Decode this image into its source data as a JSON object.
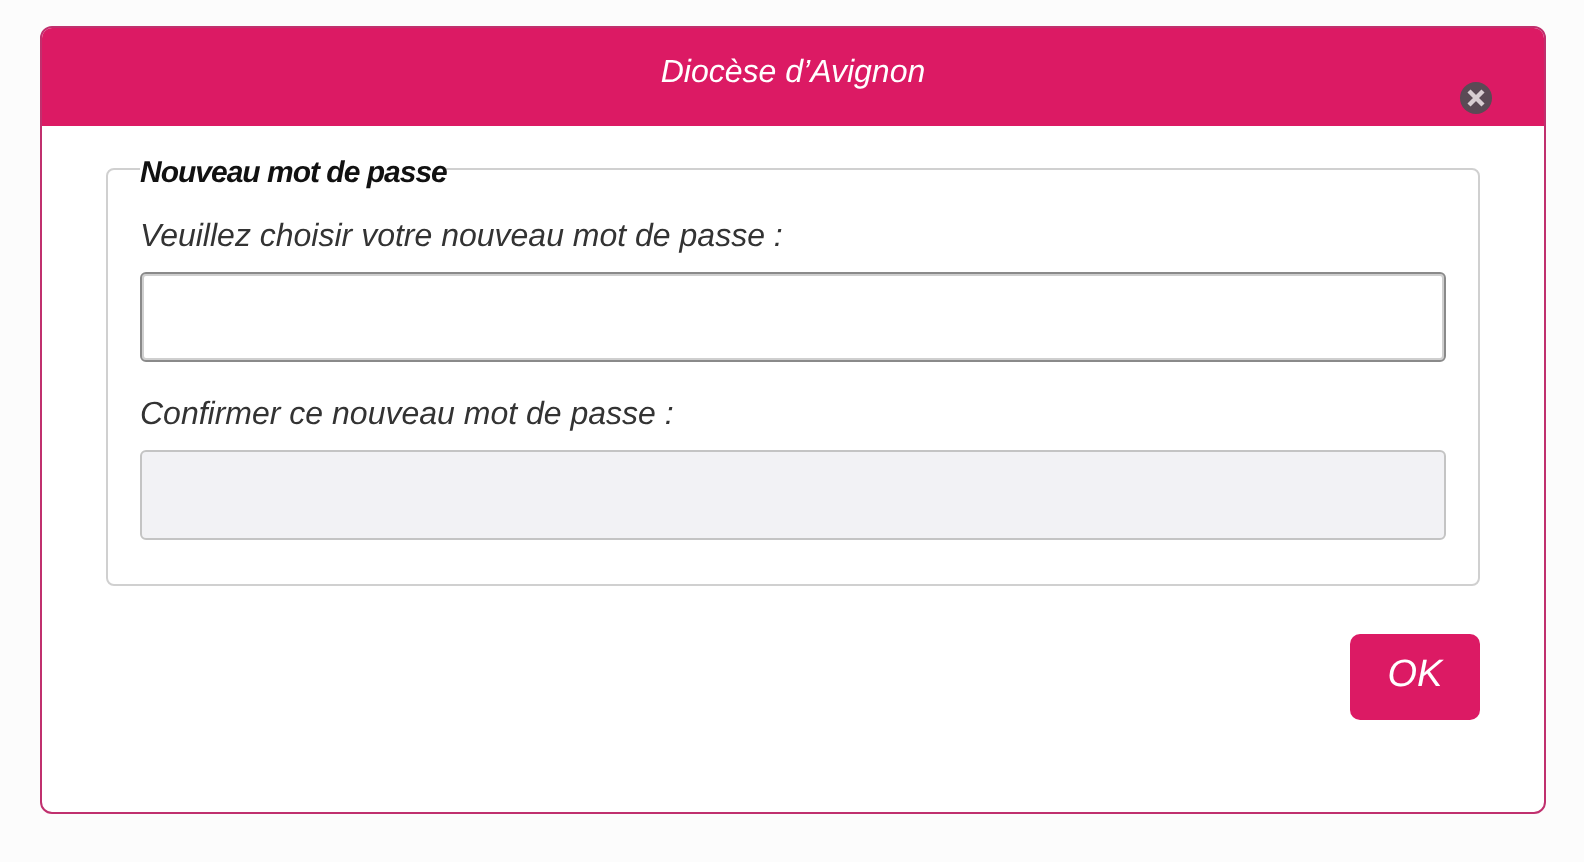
{
  "dialog": {
    "title": "Diocèse d’Avignon"
  },
  "fieldset": {
    "legend": "Nouveau mot de passe",
    "fields": [
      {
        "label": "Veuillez choisir votre nouveau mot de passe :",
        "focused": true,
        "disabled": false
      },
      {
        "label": "Confirmer ce nouveau mot de passe :",
        "focused": false,
        "disabled": true
      }
    ]
  },
  "buttons": [
    {
      "label": "OK"
    }
  ]
}
